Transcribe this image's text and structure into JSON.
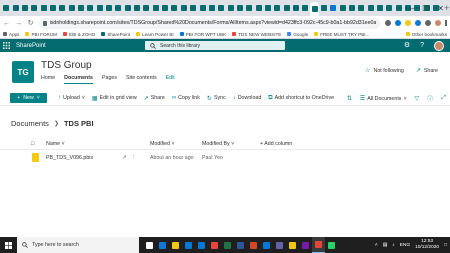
{
  "browser": {
    "tabs": [
      {
        "favicon": "sharepoint-favicon",
        "color": "#036c70",
        "active": false
      },
      {
        "favicon": "sharepoint-favicon",
        "color": "#036c70",
        "active": false
      },
      {
        "favicon": "sharepoint-favicon",
        "color": "#036c70",
        "active": false
      },
      {
        "favicon": "sharepoint-favicon",
        "color": "#036c70",
        "active": false
      },
      {
        "favicon": "sharepoint-favicon",
        "color": "#036c70",
        "active": false
      },
      {
        "favicon": "sharepoint-favicon",
        "color": "#036c70",
        "active": false
      },
      {
        "favicon": "sharepoint-favicon",
        "color": "#036c70",
        "active": false
      },
      {
        "favicon": "sharepoint-favicon",
        "color": "#036c70",
        "active": false
      },
      {
        "favicon": "sharepoint-favicon",
        "color": "#036c70",
        "active": false
      },
      {
        "favicon": "sharepoint-favicon",
        "color": "#036c70",
        "active": false
      },
      {
        "favicon": "sharepoint-favicon",
        "color": "#036c70",
        "active": false
      },
      {
        "favicon": "sharepoint-favicon",
        "color": "#036c70",
        "active": false
      },
      {
        "favicon": "sharepoint-favicon",
        "color": "#036c70",
        "active": false
      },
      {
        "favicon": "sharepoint-favicon",
        "color": "#036c70",
        "active": false
      },
      {
        "favicon": "sharepoint-favicon",
        "color": "#036c70",
        "active": false
      },
      {
        "favicon": "sharepoint-favicon",
        "color": "#036c70",
        "active": false
      },
      {
        "favicon": "sharepoint-favicon",
        "color": "#036c70",
        "active": false
      },
      {
        "favicon": "sharepoint-favicon",
        "color": "#036c70",
        "active": false
      },
      {
        "favicon": "sharepoint-favicon",
        "color": "#036c70",
        "active": false
      },
      {
        "favicon": "sharepoint-favicon",
        "color": "#036c70",
        "active": false
      },
      {
        "favicon": "sharepoint-favicon",
        "color": "#036c70",
        "active": false
      },
      {
        "favicon": "sharepoint-favicon",
        "color": "#036c70",
        "active": false
      },
      {
        "favicon": "sharepoint-favicon",
        "color": "#036c70",
        "active": false
      },
      {
        "favicon": "sharepoint-favicon",
        "color": "#036c70",
        "active": false
      },
      {
        "favicon": "sharepoint-favicon",
        "color": "#036c70",
        "active": false
      },
      {
        "favicon": "sharepoint-favicon",
        "color": "#036c70",
        "active": false
      },
      {
        "favicon": "sharepoint-favicon",
        "color": "#036c70",
        "active": false
      },
      {
        "favicon": "sharepoint-favicon",
        "color": "#036c70",
        "active": false
      },
      {
        "favicon": "sharepoint-favicon",
        "color": "#036c70",
        "active": false
      },
      {
        "favicon": "sharepoint-favicon",
        "color": "#036c70",
        "active": false
      },
      {
        "favicon": "sharepoint-favicon",
        "color": "#036c70",
        "active": false
      },
      {
        "favicon": "sharepoint-favicon",
        "color": "#036c70",
        "active": false
      },
      {
        "favicon": "sharepoint-favicon",
        "color": "#036c70",
        "active": false
      },
      {
        "favicon": "sharepoint-favicon",
        "color": "#036c70",
        "active": true
      },
      {
        "favicon": "sharepoint-favicon",
        "color": "#036c70",
        "active": false
      },
      {
        "favicon": "onedrive-favicon",
        "color": "#0f78d4",
        "active": false
      },
      {
        "favicon": "sharepoint-favicon",
        "color": "#036c70",
        "active": false
      },
      {
        "favicon": "sharepoint-favicon",
        "color": "#036c70",
        "active": false
      },
      {
        "favicon": "sharepoint-favicon",
        "color": "#036c70",
        "active": false
      },
      {
        "favicon": "sharepoint-favicon",
        "color": "#036c70",
        "active": false
      },
      {
        "favicon": "sharepoint-favicon",
        "color": "#036c70",
        "active": false
      },
      {
        "favicon": "sharepoint-favicon",
        "color": "#036c70",
        "active": false
      },
      {
        "favicon": "sharepoint-favicon",
        "color": "#036c70",
        "active": false
      },
      {
        "favicon": "sharepoint-favicon",
        "color": "#036c70",
        "active": false
      },
      {
        "favicon": "sharepoint-favicon",
        "color": "#036c70",
        "active": false
      },
      {
        "favicon": "sharepoint-favicon",
        "color": "#036c70",
        "active": false
      },
      {
        "favicon": "sharepoint-favicon",
        "color": "#036c70",
        "active": false
      }
    ],
    "new_tab_label": "+",
    "url": "isdnholdings.sharepoint.com/sites/TDSGroup/Shared%20Documents/Forms/AllItems.aspx?viewid=d423ffc3-092c-45c9-b0a1-bb92d31ee0aa&id=%2Fsite..."
  },
  "bookmarks": {
    "items": [
      {
        "label": "Apps",
        "color": "#5f6368"
      },
      {
        "label": "PBI FORUM",
        "color": "#f2c811"
      },
      {
        "label": "EBI & ZOHO",
        "color": "#e8453c"
      },
      {
        "label": "SharePoint",
        "color": "#036c70"
      },
      {
        "label": "Learn Power BI",
        "color": "#f2c811"
      },
      {
        "label": "PBI FOR WPT UBK",
        "color": "#0078d4"
      },
      {
        "label": "TDS NEW WEBSITE",
        "color": "#e8453c"
      },
      {
        "label": "Google",
        "color": "#4285f4"
      },
      {
        "label": "FREE MUST TRY PBI...",
        "color": "#f2c811"
      }
    ],
    "other_label": "Other bookmarks"
  },
  "suite": {
    "app_name": "SharePoint",
    "search_placeholder": "Search this library",
    "brand_color": "#036c70"
  },
  "site": {
    "logo_initials": "TG",
    "title": "TDS Group",
    "nav": [
      "Home",
      "Documents",
      "Pages",
      "Site contents",
      "Edit"
    ],
    "not_following_label": "Not following",
    "share_label": "Share"
  },
  "commands": {
    "new_label": "New",
    "upload_label": "Upload",
    "grid_view_label": "Edit in grid view",
    "share_label": "Share",
    "copy_link_label": "Copy link",
    "sync_label": "Sync",
    "download_label": "Download",
    "add_shortcut_label": "Add shortcut to OneDrive",
    "view_label": "All Documents"
  },
  "breadcrumb": {
    "root": "Documents",
    "current": "TDS PBI"
  },
  "list": {
    "columns": {
      "name": "Name",
      "modified": "Modified",
      "modified_by": "Modified By",
      "add_column": "+ Add column"
    },
    "rows": [
      {
        "name": "PB_TDS_V096.pbix",
        "modified": "About an hour ago",
        "modified_by": "Paul Yeo"
      }
    ]
  },
  "taskbar": {
    "search_placeholder": "Type here to search",
    "apps": [
      {
        "name": "task-view-icon",
        "color": "#ffffff"
      },
      {
        "name": "edge-icon",
        "color": "#0f78d4"
      },
      {
        "name": "file-explorer-icon",
        "color": "#f2c811"
      },
      {
        "name": "store-icon",
        "color": "#0078d4"
      },
      {
        "name": "mail-icon",
        "color": "#0078d4"
      },
      {
        "name": "chrome-icon",
        "color": "#e8453c"
      },
      {
        "name": "excel-icon",
        "color": "#217346"
      },
      {
        "name": "word-icon",
        "color": "#2b579a"
      },
      {
        "name": "powerpoint-icon",
        "color": "#d24726"
      },
      {
        "name": "outlook-icon",
        "color": "#0078d4"
      },
      {
        "name": "teams-icon",
        "color": "#6264a7"
      },
      {
        "name": "power-bi-icon",
        "color": "#f2c811"
      },
      {
        "name": "onenote-icon",
        "color": "#7719aa"
      },
      {
        "name": "chrome-icon",
        "color": "#e8453c",
        "active": true
      },
      {
        "name": "whatsapp-icon",
        "color": "#25d366"
      }
    ],
    "language": "ENG",
    "time": "12:53",
    "date": "10/12/2020"
  }
}
